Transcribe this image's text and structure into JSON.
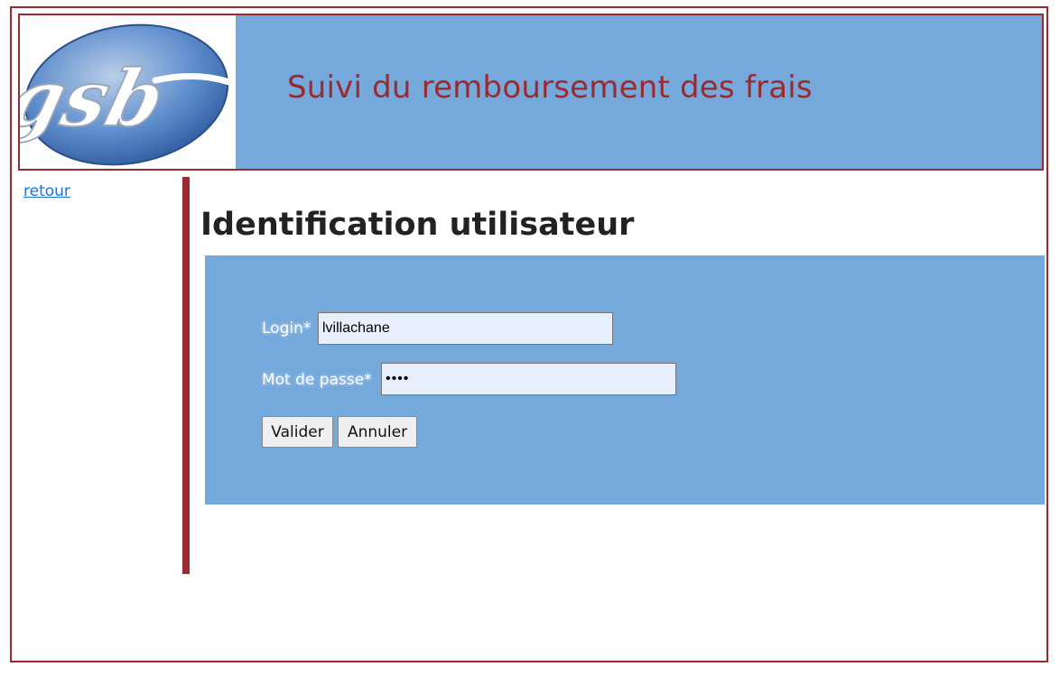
{
  "header": {
    "logo_text": "gsb",
    "title": "Suivi du remboursement des frais"
  },
  "nav": {
    "back_link": "retour"
  },
  "main": {
    "title": "Identification utilisateur",
    "form": {
      "login_label": "Login*",
      "login_value": "lvillachane",
      "password_label": "Mot de passe*",
      "password_value": "••••",
      "submit_label": "Valider",
      "cancel_label": "Annuler"
    }
  },
  "colors": {
    "accent": "#9b2a2e",
    "panel": "#75a9dc",
    "link": "#1a73d9"
  }
}
